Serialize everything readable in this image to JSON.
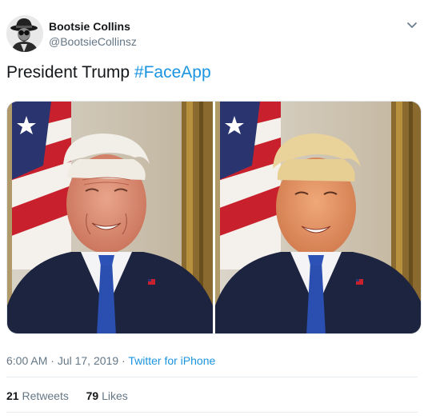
{
  "tweet": {
    "author": {
      "name": "Bootsie Collins",
      "handle": "@BootsieCollinsz"
    },
    "text": "President Trump",
    "hashtag": "#FaceApp",
    "time": "6:00 AM",
    "sep1": " · ",
    "date": "Jul 17, 2019",
    "sep2": " · ",
    "source": "Twitter for iPhone",
    "retweets_count": "21",
    "retweets_label": "Retweets",
    "likes_count": "79",
    "likes_label": "Likes"
  },
  "colors": {
    "link": "#1b95e0",
    "secondary_text": "#657786",
    "primary_text": "#14171a",
    "divider": "#e6ecf0"
  },
  "icons": {
    "caret": "chevron-down-icon"
  },
  "media": {
    "count_photos": 2
  }
}
